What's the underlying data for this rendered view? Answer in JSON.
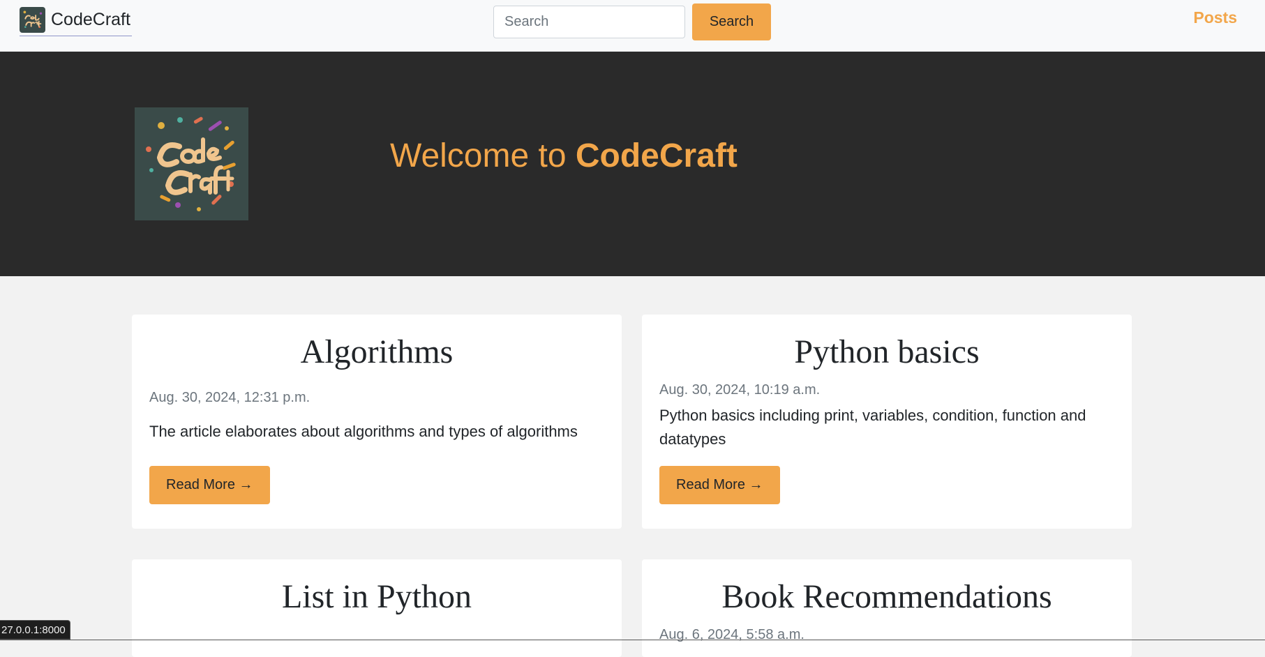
{
  "navbar": {
    "brand_name": "CodeCraft",
    "search_placeholder": "Search",
    "search_button_label": "Search",
    "posts_link_label": "Posts"
  },
  "hero": {
    "title_prefix": "Welcome to ",
    "title_brand": "CodeCraft"
  },
  "posts": [
    {
      "title": "Algorithms",
      "date": "Aug. 30, 2024, 12:31 p.m.",
      "description": "The article elaborates about algorithms and types of algorithms",
      "read_more_label": "Read More →"
    },
    {
      "title": "Python basics",
      "date": "Aug. 30, 2024, 10:19 a.m.",
      "description": "Python basics including print, variables, condition, function and datatypes",
      "read_more_label": "Read More →"
    },
    {
      "title": "List in Python"
    },
    {
      "title": "Book Recommendations",
      "date": "Aug. 6, 2024, 5:58 a.m."
    }
  ],
  "status_bar": {
    "url": "27.0.0.1:8000"
  },
  "logo": {
    "lettering": "Code Craft",
    "background_color": "#3a4b49",
    "text_color": "#f0c58e"
  },
  "colors": {
    "accent": "#f2a64a",
    "hero_background": "#2a2a2a",
    "page_background": "#f2f2f2"
  }
}
